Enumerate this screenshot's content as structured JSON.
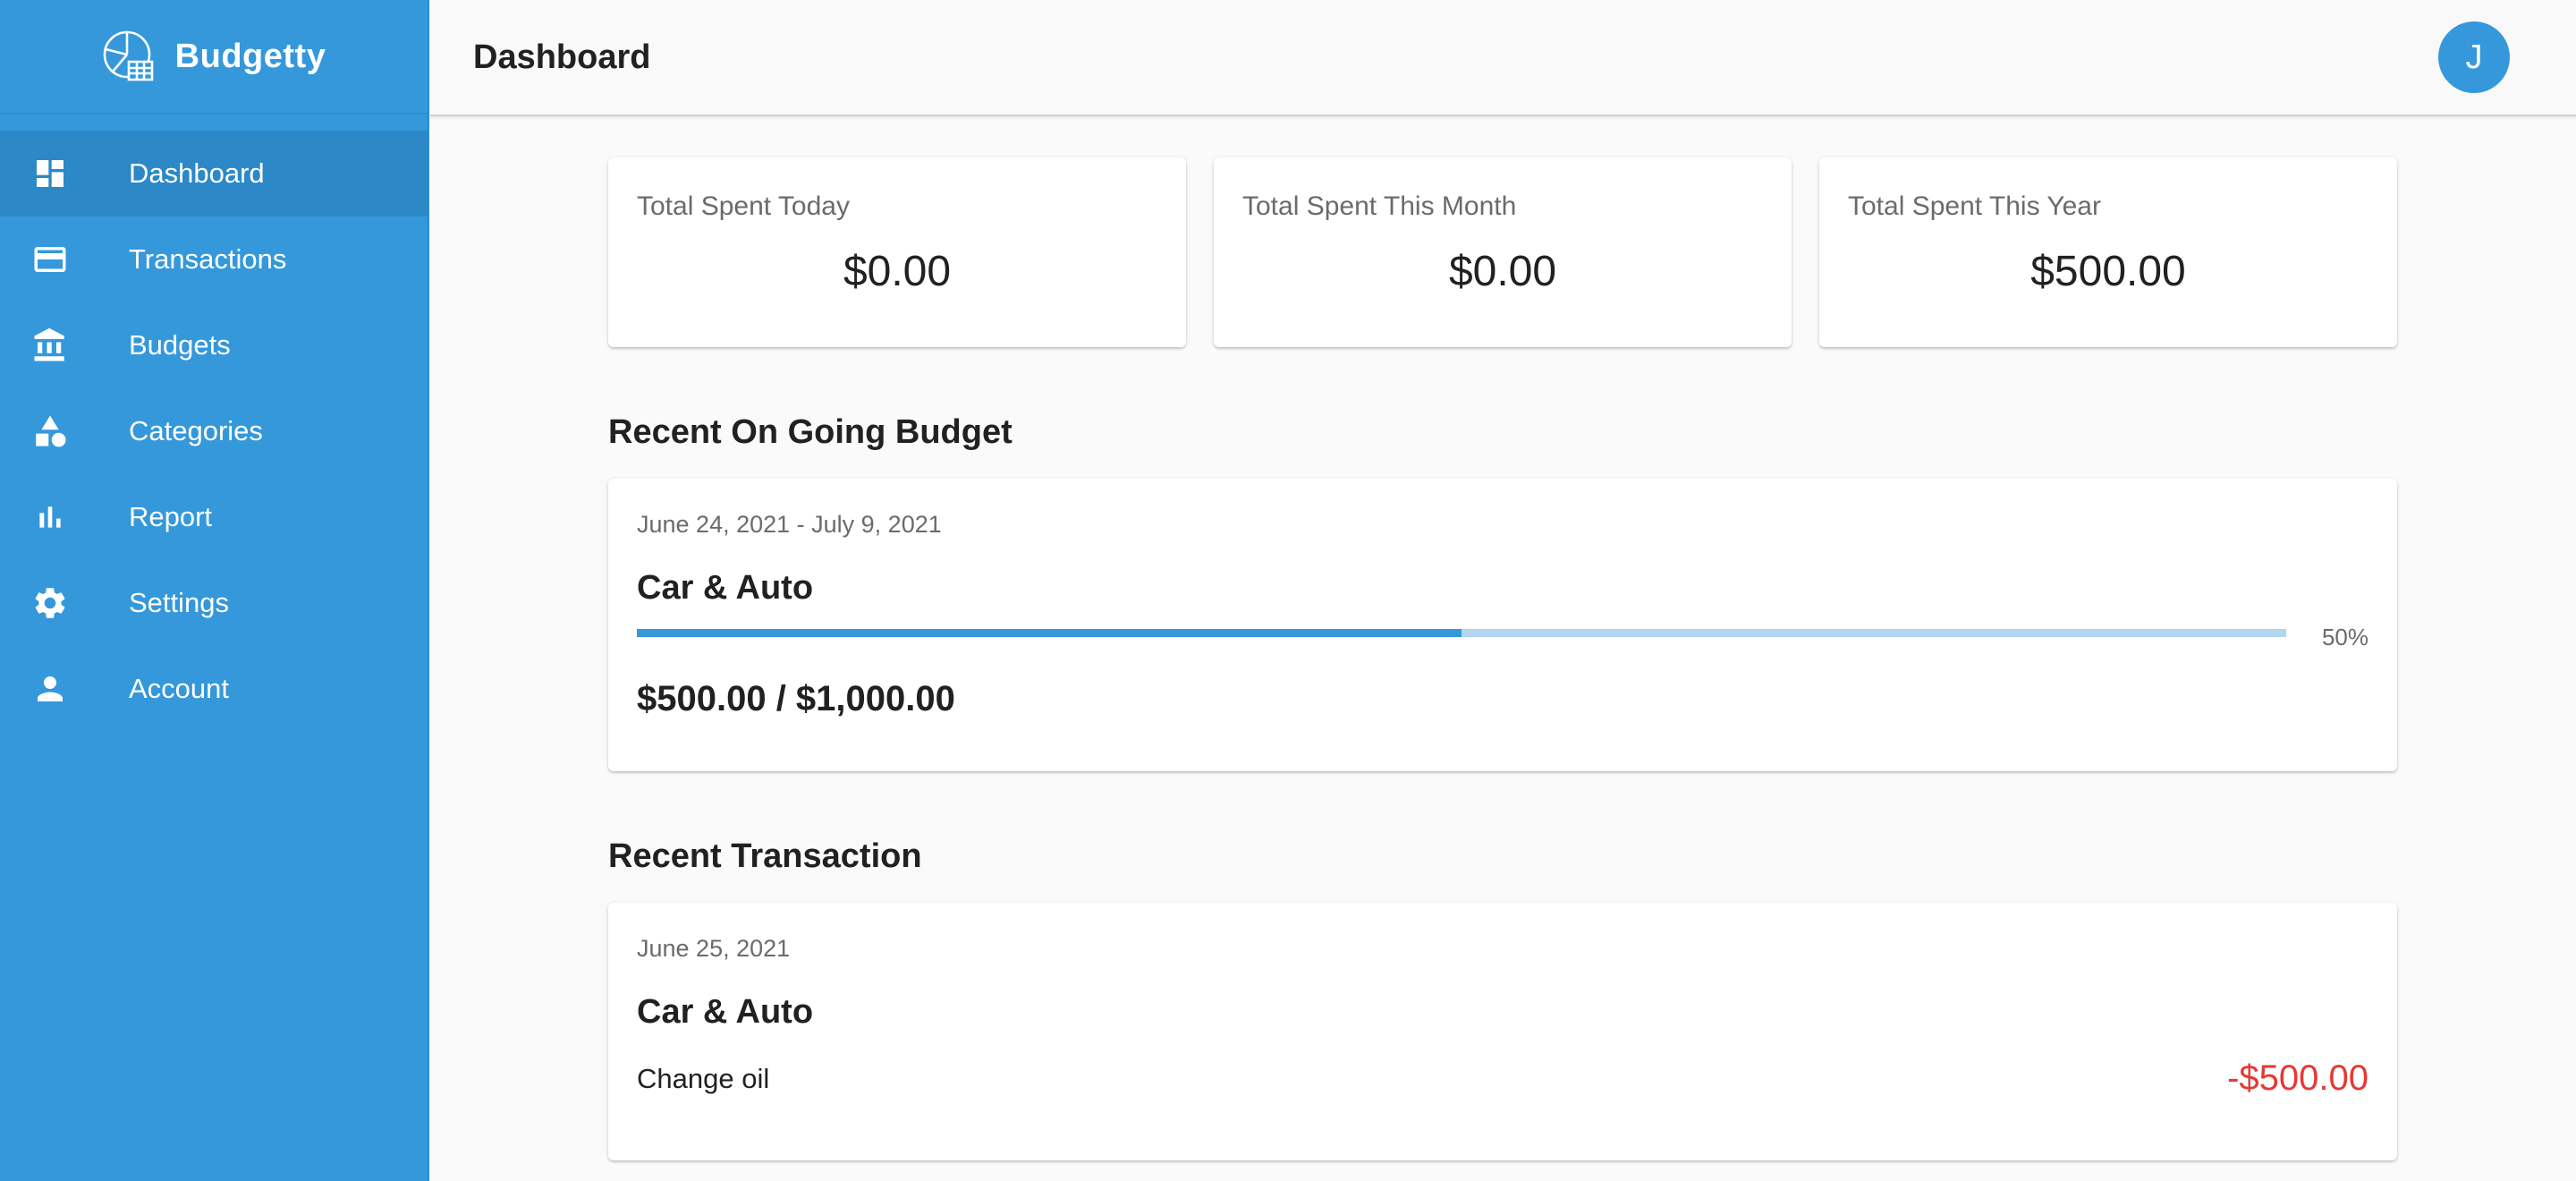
{
  "app": {
    "name": "Budgetty"
  },
  "sidebar": {
    "items": [
      {
        "label": "Dashboard",
        "icon": "dashboard-icon",
        "active": true
      },
      {
        "label": "Transactions",
        "icon": "credit-card-icon"
      },
      {
        "label": "Budgets",
        "icon": "bank-icon"
      },
      {
        "label": "Categories",
        "icon": "shapes-icon"
      },
      {
        "label": "Report",
        "icon": "bar-chart-icon"
      },
      {
        "label": "Settings",
        "icon": "gear-icon"
      },
      {
        "label": "Account",
        "icon": "person-icon"
      }
    ]
  },
  "header": {
    "title": "Dashboard",
    "avatar_initial": "J"
  },
  "stats": [
    {
      "label": "Total Spent Today",
      "value": "$0.00"
    },
    {
      "label": "Total Spent This Month",
      "value": "$0.00"
    },
    {
      "label": "Total Spent This Year",
      "value": "$500.00"
    }
  ],
  "budget": {
    "section_title": "Recent On Going Budget",
    "date_range": "June 24, 2021 - July 9, 2021",
    "category": "Car & Auto",
    "progress_percent": 50,
    "progress_label": "50%",
    "amount": "$500.00 / $1,000.00"
  },
  "transaction": {
    "section_title": "Recent Transaction",
    "date": "June 25, 2021",
    "category": "Car & Auto",
    "note": "Change oil",
    "amount": "-$500.00"
  },
  "colors": {
    "primary": "#3498db",
    "sidebar_active": "#2c88c6",
    "progress_track": "#b3d6ef",
    "negative": "#e53935"
  }
}
